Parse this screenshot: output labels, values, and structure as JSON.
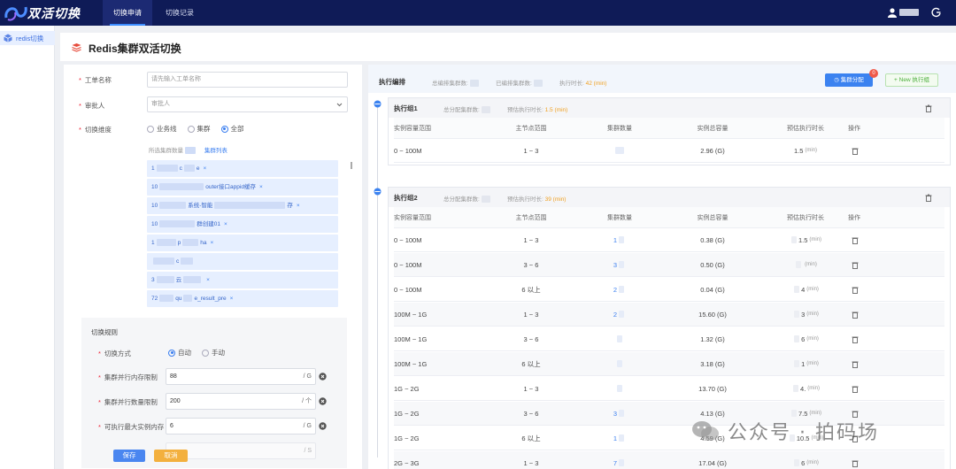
{
  "topbar": {
    "logo_text": "双活切换",
    "tabs": [
      {
        "label": "切换申请",
        "active": true
      },
      {
        "label": "切换记录",
        "active": false
      }
    ]
  },
  "sidebar": {
    "items": [
      {
        "label": "redis切换",
        "icon": "cube-icon"
      }
    ]
  },
  "header": {
    "title": "Redis集群双活切换"
  },
  "form": {
    "name_label": "工单名称",
    "name_placeholder": "请先输入工单名称",
    "approver_label": "审批人",
    "approver_placeholder": "审批人",
    "dimension_label": "切换维度",
    "dimension_options": [
      "业务线",
      "集群",
      "全部"
    ],
    "dimension_selected": "全部",
    "selected_count_label": "所选集群数量",
    "cluster_list_link": "集群列表",
    "clusters": [
      {
        "prefix": "1",
        "name": "c",
        "suffix": "e"
      },
      {
        "prefix": "10",
        "name": "",
        "suffix": "outer接口appid缓存"
      },
      {
        "prefix": "10",
        "name": "",
        "suffix": "系统-智能"
      },
      {
        "prefix": "10",
        "name": "",
        "suffix": "群创建01"
      },
      {
        "prefix": "1",
        "name": "p",
        "suffix": "ha"
      },
      {
        "prefix": "",
        "name": "",
        "suffix": "c"
      },
      {
        "prefix": "3",
        "name": "",
        "suffix": "云"
      },
      {
        "prefix": "72",
        "name": "qu",
        "suffix": "e_result_pre"
      }
    ],
    "rules": {
      "title": "切换规则",
      "mode_label": "切换方式",
      "mode_options": [
        "自动",
        "手动"
      ],
      "mode_selected": "自动",
      "mem_limit_label": "集群并行内存限制",
      "mem_limit_value": "88",
      "mem_limit_unit": "/ G",
      "count_limit_label": "集群并行数量限制",
      "count_limit_value": "200",
      "count_limit_unit": "/ 个",
      "max_mem_label": "可执行最大实例内存",
      "max_mem_value": "6",
      "max_mem_unit": "/ G",
      "next_unit": "/ S"
    },
    "save_label": "保存",
    "cancel_label": "取消"
  },
  "exec": {
    "title": "执行编排",
    "total_label": "总编排集群数:",
    "done_label": "已编排集群数:",
    "duration_label": "执行时长:",
    "duration_value": "42",
    "duration_unit": "(min)",
    "cluster_assign_label": "集群分配",
    "cluster_assign_badge": "0",
    "new_group_label": "+ New 执行组",
    "columns": [
      "实例容量范围",
      "主节点范围",
      "集群数量",
      "实例总容量",
      "预估执行时长",
      "操作"
    ],
    "groups": [
      {
        "title": "执行组1",
        "assigned_label": "总分配集群数:",
        "est_label": "预估执行时长:",
        "est_value": "1.5",
        "est_unit": "(min)",
        "rows": [
          {
            "range": "0 ~ 100M",
            "nodes": "1 ~ 3",
            "count": "",
            "total": "2.96 (G)",
            "duration": "1.5",
            "dur_unit": "(min)"
          }
        ]
      },
      {
        "title": "执行组2",
        "assigned_label": "总分配集群数:",
        "est_label": "预估执行时长:",
        "est_value": "39",
        "est_unit": "(min)",
        "rows": [
          {
            "range": "0 ~ 100M",
            "nodes": "1 ~ 3",
            "count": "1",
            "total": "0.38 (G)",
            "duration": "1.5",
            "dur_unit": "(min)"
          },
          {
            "range": "0 ~ 100M",
            "nodes": "3 ~ 6",
            "count": "3",
            "total": "0.50 (G)",
            "duration": "",
            "dur_unit": "(min)"
          },
          {
            "range": "0 ~ 100M",
            "nodes": "6 以上",
            "count": "2",
            "total": "0.04 (G)",
            "duration": "4",
            "dur_unit": "(min)"
          },
          {
            "range": "100M ~ 1G",
            "nodes": "1 ~ 3",
            "count": "2",
            "total": "15.60 (G)",
            "duration": "3",
            "dur_unit": "(min)"
          },
          {
            "range": "100M ~ 1G",
            "nodes": "3 ~ 6",
            "count": "",
            "total": "1.32 (G)",
            "duration": "6",
            "dur_unit": "(min)"
          },
          {
            "range": "100M ~ 1G",
            "nodes": "6 以上",
            "count": "",
            "total": "3.18 (G)",
            "duration": "1",
            "dur_unit": "(min)"
          },
          {
            "range": "1G ~ 2G",
            "nodes": "1 ~ 3",
            "count": "",
            "total": "13.70 (G)",
            "duration": "4.",
            "dur_unit": "(min)"
          },
          {
            "range": "1G ~ 2G",
            "nodes": "3 ~ 6",
            "count": "3",
            "total": "4.13 (G)",
            "duration": "7.5",
            "dur_unit": "(min)"
          },
          {
            "range": "1G ~ 2G",
            "nodes": "6 以上",
            "count": "1",
            "total": "4.59 (G)",
            "duration": "10.5",
            "dur_unit": "(min)"
          },
          {
            "range": "2G ~ 3G",
            "nodes": "1 ~ 3",
            "count": "7",
            "total": "17.04 (G)",
            "duration": "6",
            "dur_unit": "(min)"
          }
        ]
      }
    ]
  },
  "watermark": {
    "text": "公众号 · 拍码场"
  }
}
